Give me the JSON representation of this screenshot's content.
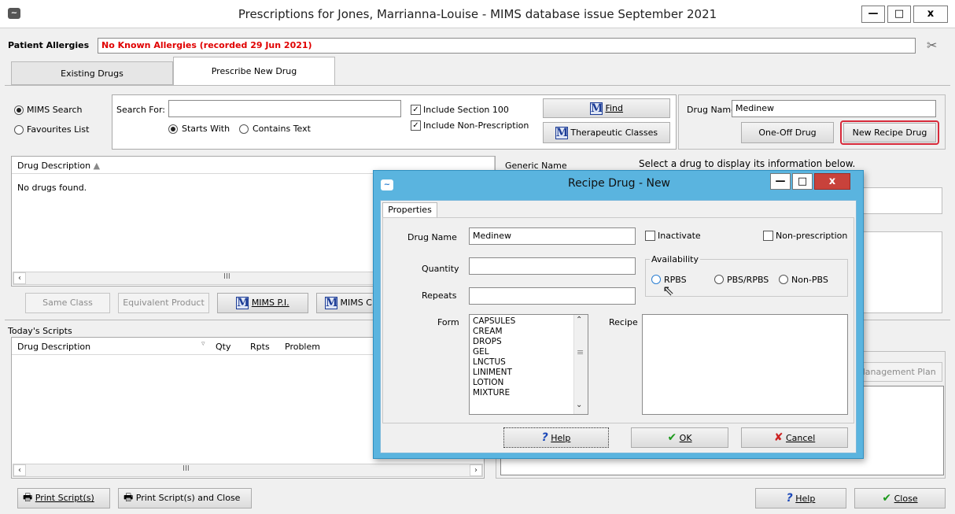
{
  "window": {
    "title": "Prescriptions for Jones, Marrianna-Louise  - MIMS database issue September 2021",
    "minimize": "—",
    "maximize": "□",
    "close": "x"
  },
  "allergies": {
    "label": "Patient Allergies",
    "value": "No Known Allergies (recorded 29 Jun 2021)"
  },
  "tabs": {
    "existing": "Existing Drugs",
    "prescribe": "Prescribe New Drug"
  },
  "search": {
    "mims_search": "MIMS Search",
    "favourites": "Favourites List",
    "search_for_label": "Search For:",
    "search_for_value": "",
    "starts_with": "Starts With",
    "contains_text": "Contains Text",
    "include_s100": "Include Section 100",
    "include_nonrx": "Include Non-Prescription",
    "find": "Find",
    "therapeutic": "Therapeutic Classes"
  },
  "drug_name": {
    "label": "Drug Name:",
    "value": "Medinew",
    "one_off": "One-Off Drug",
    "new_recipe": "New Recipe Drug"
  },
  "drug_list": {
    "col_description": "Drug Description",
    "col_generic": "Generic Name",
    "empty": "No drugs found.",
    "info_text": "Select a drug to display its information below."
  },
  "drug_buttons": {
    "same_class": "Same Class",
    "equivalent": "Equivalent Product",
    "mims_pi": "MIMS P.I.",
    "mims_c": "MIMS C"
  },
  "scripts": {
    "title": "Today's Scripts",
    "col_description": "Drug Description",
    "col_qty": "Qty",
    "col_rpts": "Rpts",
    "col_problem": "Problem",
    "mgmt_plan": "Management Plan"
  },
  "bottom": {
    "print": "Print Script(s)",
    "print_close": "Print Script(s) and Close",
    "help": "Help",
    "close": "Close"
  },
  "dialog": {
    "title": "Recipe Drug - New",
    "tab": "Properties",
    "drug_name_label": "Drug Name",
    "drug_name_value": "Medinew",
    "inactivate": "Inactivate",
    "non_prescription": "Non-prescription",
    "quantity_label": "Quantity",
    "repeats_label": "Repeats",
    "availability_label": "Availability",
    "rpbs": "RPBS",
    "pbs_rpbs": "PBS/RPBS",
    "non_pbs": "Non-PBS",
    "form_label": "Form",
    "recipe_label": "Recipe",
    "forms": [
      "CAPSULES",
      "CREAM",
      "DROPS",
      "GEL",
      "LNCTUS",
      "LINIMENT",
      "LOTION",
      "MIXTURE"
    ],
    "help": "Help",
    "ok": "OK",
    "cancel": "Cancel"
  }
}
